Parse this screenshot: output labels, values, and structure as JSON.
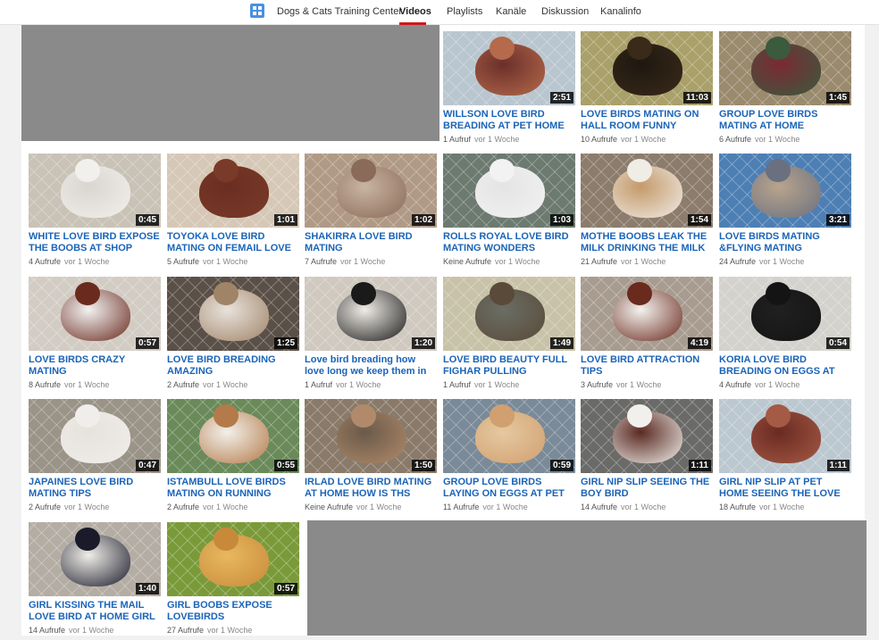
{
  "nav": {
    "channel_name": "Dogs & Cats Training Center",
    "tabs": [
      "Videos",
      "Playlists",
      "Kanäle",
      "Diskussion",
      "Kanalinfo"
    ],
    "active_tab": "Videos"
  },
  "videos": [
    {
      "title": "WILLSON LOVE BIRD BREADING AT PET HOME …",
      "duration": "2:51",
      "views": "1 Aufruf",
      "age": "vor 1 Woche",
      "colors": [
        "#b9c6cf",
        "#b46a4b",
        "#6b2f2a"
      ]
    },
    {
      "title": "LOVE BIRDS MATING ON HALL ROOM FUNNY",
      "duration": "11:03",
      "views": "10 Aufrufe",
      "age": "vor 1 Woche",
      "colors": [
        "#a9a06a",
        "#3a2a1a",
        "#1e1810"
      ]
    },
    {
      "title": "GROUP LOVE BIRDS MATING AT HOME",
      "duration": "1:45",
      "views": "6 Aufrufe",
      "age": "vor 1 Woche",
      "colors": [
        "#9a8a6e",
        "#3b5a3e",
        "#7a2a34"
      ]
    },
    {
      "title": "WHITE LOVE BIRD EXPOSE THE BOOBS AT SHOP",
      "duration": "0:45",
      "views": "4 Aufrufe",
      "age": "vor 1 Woche",
      "colors": [
        "#c9c2b6",
        "#f2f0ec",
        "#d9d6d0"
      ]
    },
    {
      "title": "TOYOKA LOVE BIRD MATING ON FEMAIL LOVE BIRD",
      "duration": "1:01",
      "views": "5 Aufrufe",
      "age": "vor 1 Woche",
      "colors": [
        "#d6c8b6",
        "#7a3a2a",
        "#6a2e20"
      ]
    },
    {
      "title": "SHAKIRRA LOVE BIRD MATING",
      "duration": "1:02",
      "views": "7 Aufrufe",
      "age": "vor 1 Woche",
      "colors": [
        "#b09a86",
        "#8a6a58",
        "#c9b4a2"
      ]
    },
    {
      "title": "ROLLS ROYAL LOVE BIRD MATING WONDERS",
      "duration": "1:03",
      "views": "Keine Aufrufe",
      "age": "vor 1 Woche",
      "colors": [
        "#6c7a70",
        "#f2f2f2",
        "#e4e4e4"
      ]
    },
    {
      "title": "MOTHE BOOBS LEAK THE MILK DRINKING THE MILK OF…",
      "duration": "1:54",
      "views": "21 Aufrufe",
      "age": "vor 1 Woche",
      "colors": [
        "#8c7c6c",
        "#f0ece6",
        "#c49a6a"
      ]
    },
    {
      "title": "LOVE BIRDS MATING &FLYING MATING",
      "duration": "3:21",
      "views": "24 Aufrufe",
      "age": "vor 1 Woche",
      "colors": [
        "#4d7fb4",
        "#6a7080",
        "#b9a48c"
      ]
    },
    {
      "title": "LOVE BIRDS CRAZY MATING",
      "duration": "0:57",
      "views": "8 Aufrufe",
      "age": "vor 1 Woche",
      "colors": [
        "#d2ccc4",
        "#6a2a1e",
        "#f2f2f2"
      ]
    },
    {
      "title": "LOVE BIRD BREADING AMAZING",
      "duration": "1:25",
      "views": "2 Aufrufe",
      "age": "vor 1 Woche",
      "colors": [
        "#5a5048",
        "#a08468",
        "#e8e2dc"
      ]
    },
    {
      "title": "Love bird breading how love long we keep them in box",
      "duration": "1:20",
      "views": "1 Aufruf",
      "age": "vor 1 Woche",
      "colors": [
        "#cfc9bf",
        "#1a1a1a",
        "#f0ece6"
      ]
    },
    {
      "title": "LOVE BIRD BEAUTY FULL FIGHAR PULLING",
      "duration": "1:49",
      "views": "1 Aufruf",
      "age": "vor 1 Woche",
      "colors": [
        "#c8c2a8",
        "#5a4a3a",
        "#6a6e64"
      ]
    },
    {
      "title": "LOVE BIRD ATTRACTION TIPS",
      "duration": "4:19",
      "views": "3 Aufrufe",
      "age": "vor 1 Woche",
      "colors": [
        "#a89c90",
        "#6a2a1e",
        "#f4f2ee"
      ]
    },
    {
      "title": "KORIA LOVE BIRD BREADING ON EGGS AT HOME PET CAR…",
      "duration": "0:54",
      "views": "4 Aufrufe",
      "age": "vor 1 Woche",
      "colors": [
        "#d4d2cc",
        "#141414",
        "#202020"
      ]
    },
    {
      "title": "JAPAINES LOVE BIRD MATING TIPS",
      "duration": "0:47",
      "views": "2 Aufrufe",
      "age": "vor 1 Woche",
      "colors": [
        "#9a9488",
        "#f0eeea",
        "#e6e2dc"
      ]
    },
    {
      "title": "ISTAMBULL LOVE BIRDS MATING ON RUNNING HOME",
      "duration": "0:55",
      "views": "2 Aufrufe",
      "age": "vor 1 Woche",
      "colors": [
        "#6a8a5a",
        "#b47a4a",
        "#f2f0ea"
      ]
    },
    {
      "title": "IRLAD LOVE BIRD MATING AT HOME HOW IS THS POSSIBL…",
      "duration": "1:50",
      "views": "Keine Aufrufe",
      "age": "vor 1 Woche",
      "colors": [
        "#8a7a6a",
        "#b08a6a",
        "#6a5a4a"
      ]
    },
    {
      "title": "GROUP LOVE BIRDS LAYING ON EGGS AT PET HOME CAR…",
      "duration": "0:59",
      "views": "11 Aufrufe",
      "age": "vor 1 Woche",
      "colors": [
        "#7a8a98",
        "#d0a070",
        "#e6c8a0"
      ]
    },
    {
      "title": "GIRL NIP SLIP SEEING THE BOY BIRD",
      "duration": "1:11",
      "views": "14 Aufrufe",
      "age": "vor 1 Woche",
      "colors": [
        "#6a6a68",
        "#f2f0ec",
        "#5a2a22"
      ]
    },
    {
      "title": "GIRL NIP SLIP AT PET HOME SEEING THE LOVE BIRD LEA…",
      "duration": "1:11",
      "views": "18 Aufrufe",
      "age": "vor 1 Woche",
      "colors": [
        "#bcc8d0",
        "#a45a44",
        "#6a2a22"
      ]
    },
    {
      "title": "GIRL KISSING THE MAIL LOVE BIRD AT HOME GIRL NIP SLI…",
      "duration": "1:40",
      "views": "14 Aufrufe",
      "age": "vor 1 Woche",
      "colors": [
        "#b4ada4",
        "#1a1a2a",
        "#f0eee8"
      ]
    },
    {
      "title": "GIRL BOOBS EXPOSE LOVEBIRDS",
      "duration": "0:57",
      "views": "27 Aufrufe",
      "age": "vor 1 Woche",
      "colors": [
        "#7a9a3a",
        "#c88a3a",
        "#e8b860"
      ]
    }
  ]
}
